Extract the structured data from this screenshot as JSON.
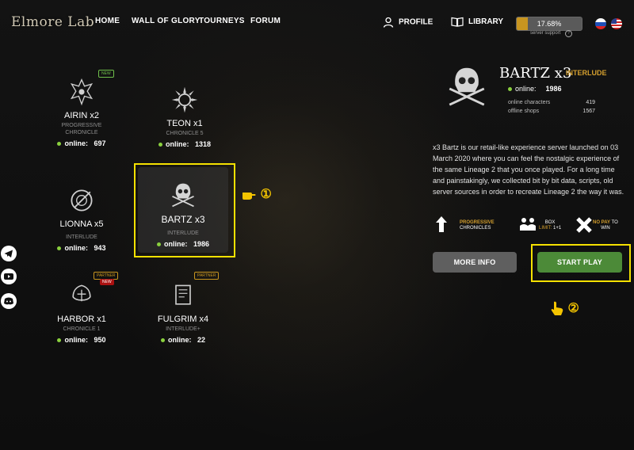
{
  "header": {
    "logo": "Elmore Lab",
    "nav": [
      "HOME",
      "WALL OF GLORY",
      "TOURNEYS",
      "FORUM"
    ],
    "profile_label": "PROFILE",
    "library_label": "LIBRARY",
    "support_progress": "17.68%",
    "support_progress_value": 0.1768,
    "support_label": "server support"
  },
  "servers": [
    {
      "name": "AIRIN x2",
      "chronicle": "PROGRESSIVE CHRONICLE",
      "online_label": "online:",
      "online": "697",
      "badge": "NEW"
    },
    {
      "name": "TEON x1",
      "chronicle": "CHRONICLE 5",
      "online_label": "online:",
      "online": "1318"
    },
    {
      "name": "LIONNA x5",
      "chronicle": "INTERLUDE",
      "online_label": "online:",
      "online": "943"
    },
    {
      "name": "BARTZ x3",
      "chronicle": "INTERLUDE",
      "online_label": "online:",
      "online": "1986"
    },
    {
      "name": "HARBOR x1",
      "chronicle": "CHRONICLE 1",
      "online_label": "online:",
      "online": "950",
      "badge": "PARTNER",
      "badge2": "NEW"
    },
    {
      "name": "FULGRIM x4",
      "chronicle": "INTERLUDE+",
      "online_label": "online:",
      "online": "22",
      "badge": "PARTNER"
    }
  ],
  "annotations": {
    "one": "①",
    "two": "②"
  },
  "detail": {
    "title": "BARTZ x3",
    "chronicle": "INTERLUDE",
    "online_label": "online:",
    "online": "1986",
    "online_characters_label": "online characters",
    "online_characters": "419",
    "offline_shops_label": "offline shops",
    "offline_shops": "1567",
    "description": "x3 Bartz is our retail-like experience server launched on 03 March 2020 where you can feel the nostalgic experience of the same Lineage 2 that you once played. For a long time and painstakingly, we collected bit by bit data, scripts, old server sources in order to recreate Lineage 2 the way it was.",
    "features": {
      "f1_line1": "PROGRESSIVE",
      "f1_line2": "CHRONICLES",
      "f2_line1": "BOX",
      "f2_line2a": "LIMIT:",
      "f2_line2b": "1+1",
      "f3_line1": "NO PAY",
      "f3_line1b": "TO",
      "f3_line2": "WIN"
    },
    "more_info": "MORE INFO",
    "start_play": "START PLAY"
  },
  "colors": {
    "accent": "#d49f2e",
    "online_dot": "#8ad03e",
    "start_btn": "#4c8a38",
    "highlight": "#f5e100"
  }
}
